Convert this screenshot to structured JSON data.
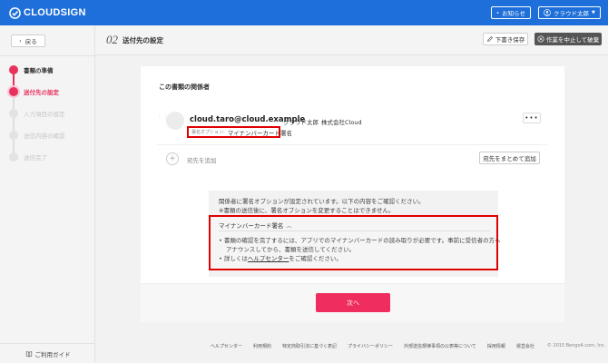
{
  "header": {
    "brand": "CLOUDSIGN",
    "notice_label": "お知らせ",
    "user_label": "クラウド太郎"
  },
  "sidebar": {
    "back_label": "戻る",
    "steps": [
      {
        "label": "書類の準備",
        "state": "done"
      },
      {
        "label": "送付先の設定",
        "state": "active"
      },
      {
        "label": "入力項目の設定",
        "state": "todo"
      },
      {
        "label": "送信内容の確認",
        "state": "todo"
      },
      {
        "label": "送信完了",
        "state": "todo"
      }
    ],
    "guide_label": "ご利用ガイド"
  },
  "titlebar": {
    "step_number": "02",
    "title": "送付先の設定",
    "draft_label": "下書き保存",
    "abort_label": "作業を中止して破棄"
  },
  "main": {
    "section_title": "この書類の関係者",
    "recipient": {
      "email": "cloud.taro@cloud.example",
      "name": "クラウド太郎",
      "company": "株式会社Cloud",
      "option_key": "署名オプション:",
      "option_value": "マイナンバーカード署名",
      "more_label": "•••"
    },
    "add_label": "宛先を追加",
    "bulk_add_label": "宛先をまとめて追加",
    "notice": {
      "line1": "関係者に署名オプションが設定されています。以下の内容をご確認ください。",
      "line2": "※書類の送信後に、署名オプションを変更することはできません。",
      "mynumber_title": "マイナンバーカード署名",
      "bullet1a": "• 書類の確認を完了するには、アプリでのマイナンバーカードの読み取りが必要です。事前に受信者の方へ",
      "bullet1b": "アナウンスしてから、書類を送信してください。",
      "bullet2_prefix": "• 詳しくは",
      "bullet2_link": "ヘルプセンター",
      "bullet2_suffix": "をご確認ください。"
    },
    "next_label": "次へ"
  },
  "footer": {
    "links": [
      "ヘルプセンター",
      "利用規約",
      "特定商取引法に基づく表記",
      "プライバシーポリシー",
      "外部送信規律事項の公表等について",
      "採用情報",
      "運営会社"
    ],
    "copyright": "© 2015 Bengo4.com, Inc."
  },
  "colors": {
    "brand_blue": "#1e6fd9",
    "accent_pink": "#ef2d5e",
    "highlight_red": "#e00000"
  }
}
